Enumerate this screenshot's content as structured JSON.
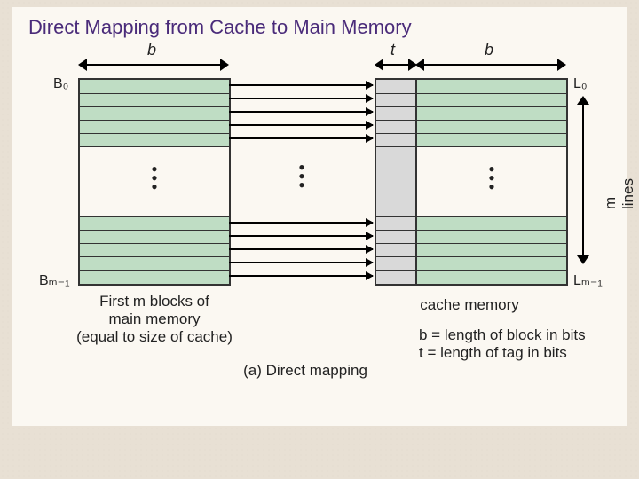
{
  "title": "Direct Mapping from Cache to Main Memory",
  "labels": {
    "b_left": "b",
    "t": "t",
    "b_right": "b",
    "B0": "B₀",
    "Bm1": "Bₘ₋₁",
    "L0": "L₀",
    "Lm1": "Lₘ₋₁",
    "mlines": "m lines",
    "main_caption_l1": "First m blocks of",
    "main_caption_l2": "main memory",
    "main_caption_l3": "(equal to size of cache)",
    "cache_caption": "cache memory",
    "legend_b": "b = length of block in bits",
    "legend_t": "t = length of tag in bits",
    "figure": "(a) Direct mapping"
  }
}
